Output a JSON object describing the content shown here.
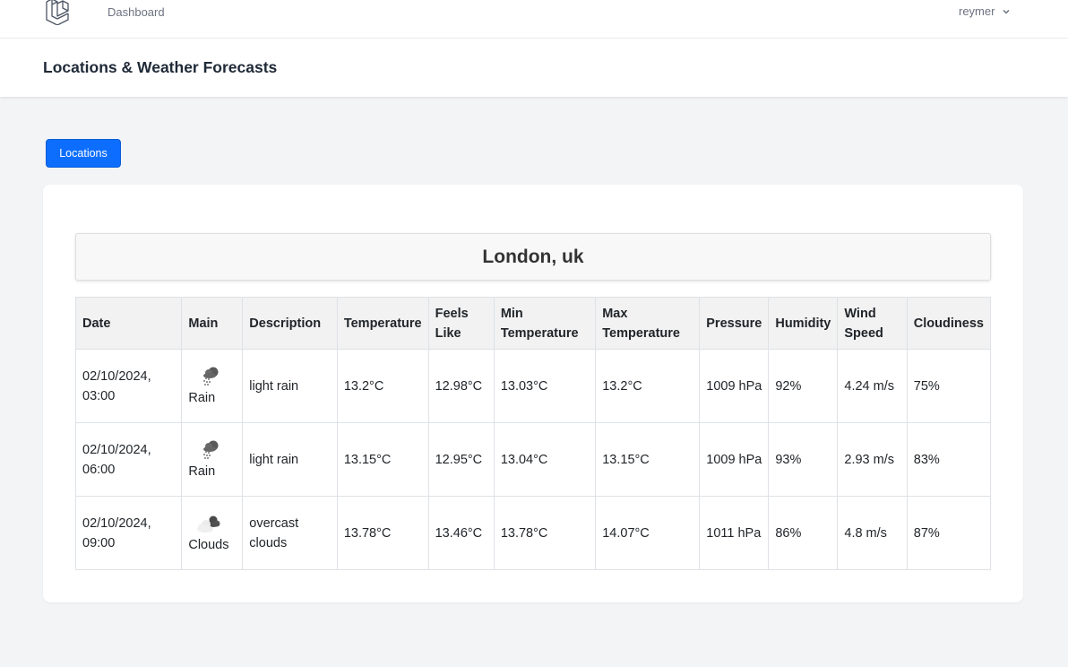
{
  "nav": {
    "dashboard_label": "Dashboard",
    "user_name": "reymer"
  },
  "header": {
    "title": "Locations & Weather Forecasts"
  },
  "actions": {
    "locations_label": "Locations"
  },
  "location": {
    "name": "London, uk"
  },
  "table": {
    "headers": {
      "date": "Date",
      "main": "Main",
      "description": "Description",
      "temperature": "Temperature",
      "feels_like": "Feels Like",
      "min_temperature": "Min Temperature",
      "max_temperature": "Max Temperature",
      "pressure": "Pressure",
      "humidity": "Humidity",
      "wind_speed": "Wind Speed",
      "cloudiness": "Cloudiness"
    },
    "rows": [
      {
        "date": "02/10/2024, 03:00",
        "icon": "rain-icon",
        "main": "Rain",
        "description": "light rain",
        "temperature": "13.2°C",
        "feels_like": "12.98°C",
        "min_temperature": "13.03°C",
        "max_temperature": "13.2°C",
        "pressure": "1009 hPa",
        "humidity": "92%",
        "wind_speed": "4.24 m/s",
        "cloudiness": "75%"
      },
      {
        "date": "02/10/2024, 06:00",
        "icon": "rain-icon",
        "main": "Rain",
        "description": "light rain",
        "temperature": "13.15°C",
        "feels_like": "12.95°C",
        "min_temperature": "13.04°C",
        "max_temperature": "13.15°C",
        "pressure": "1009 hPa",
        "humidity": "93%",
        "wind_speed": "2.93 m/s",
        "cloudiness": "83%"
      },
      {
        "date": "02/10/2024, 09:00",
        "icon": "overcast-clouds-icon",
        "main": "Clouds",
        "description": "overcast clouds",
        "temperature": "13.78°C",
        "feels_like": "13.46°C",
        "min_temperature": "13.78°C",
        "max_temperature": "14.07°C",
        "pressure": "1011 hPa",
        "humidity": "86%",
        "wind_speed": "4.8 m/s",
        "cloudiness": "87%"
      }
    ]
  },
  "colors": {
    "primary_button": "#0d6efd",
    "page_background": "#f3f4f6",
    "table_header_background": "#f2f2f2"
  }
}
